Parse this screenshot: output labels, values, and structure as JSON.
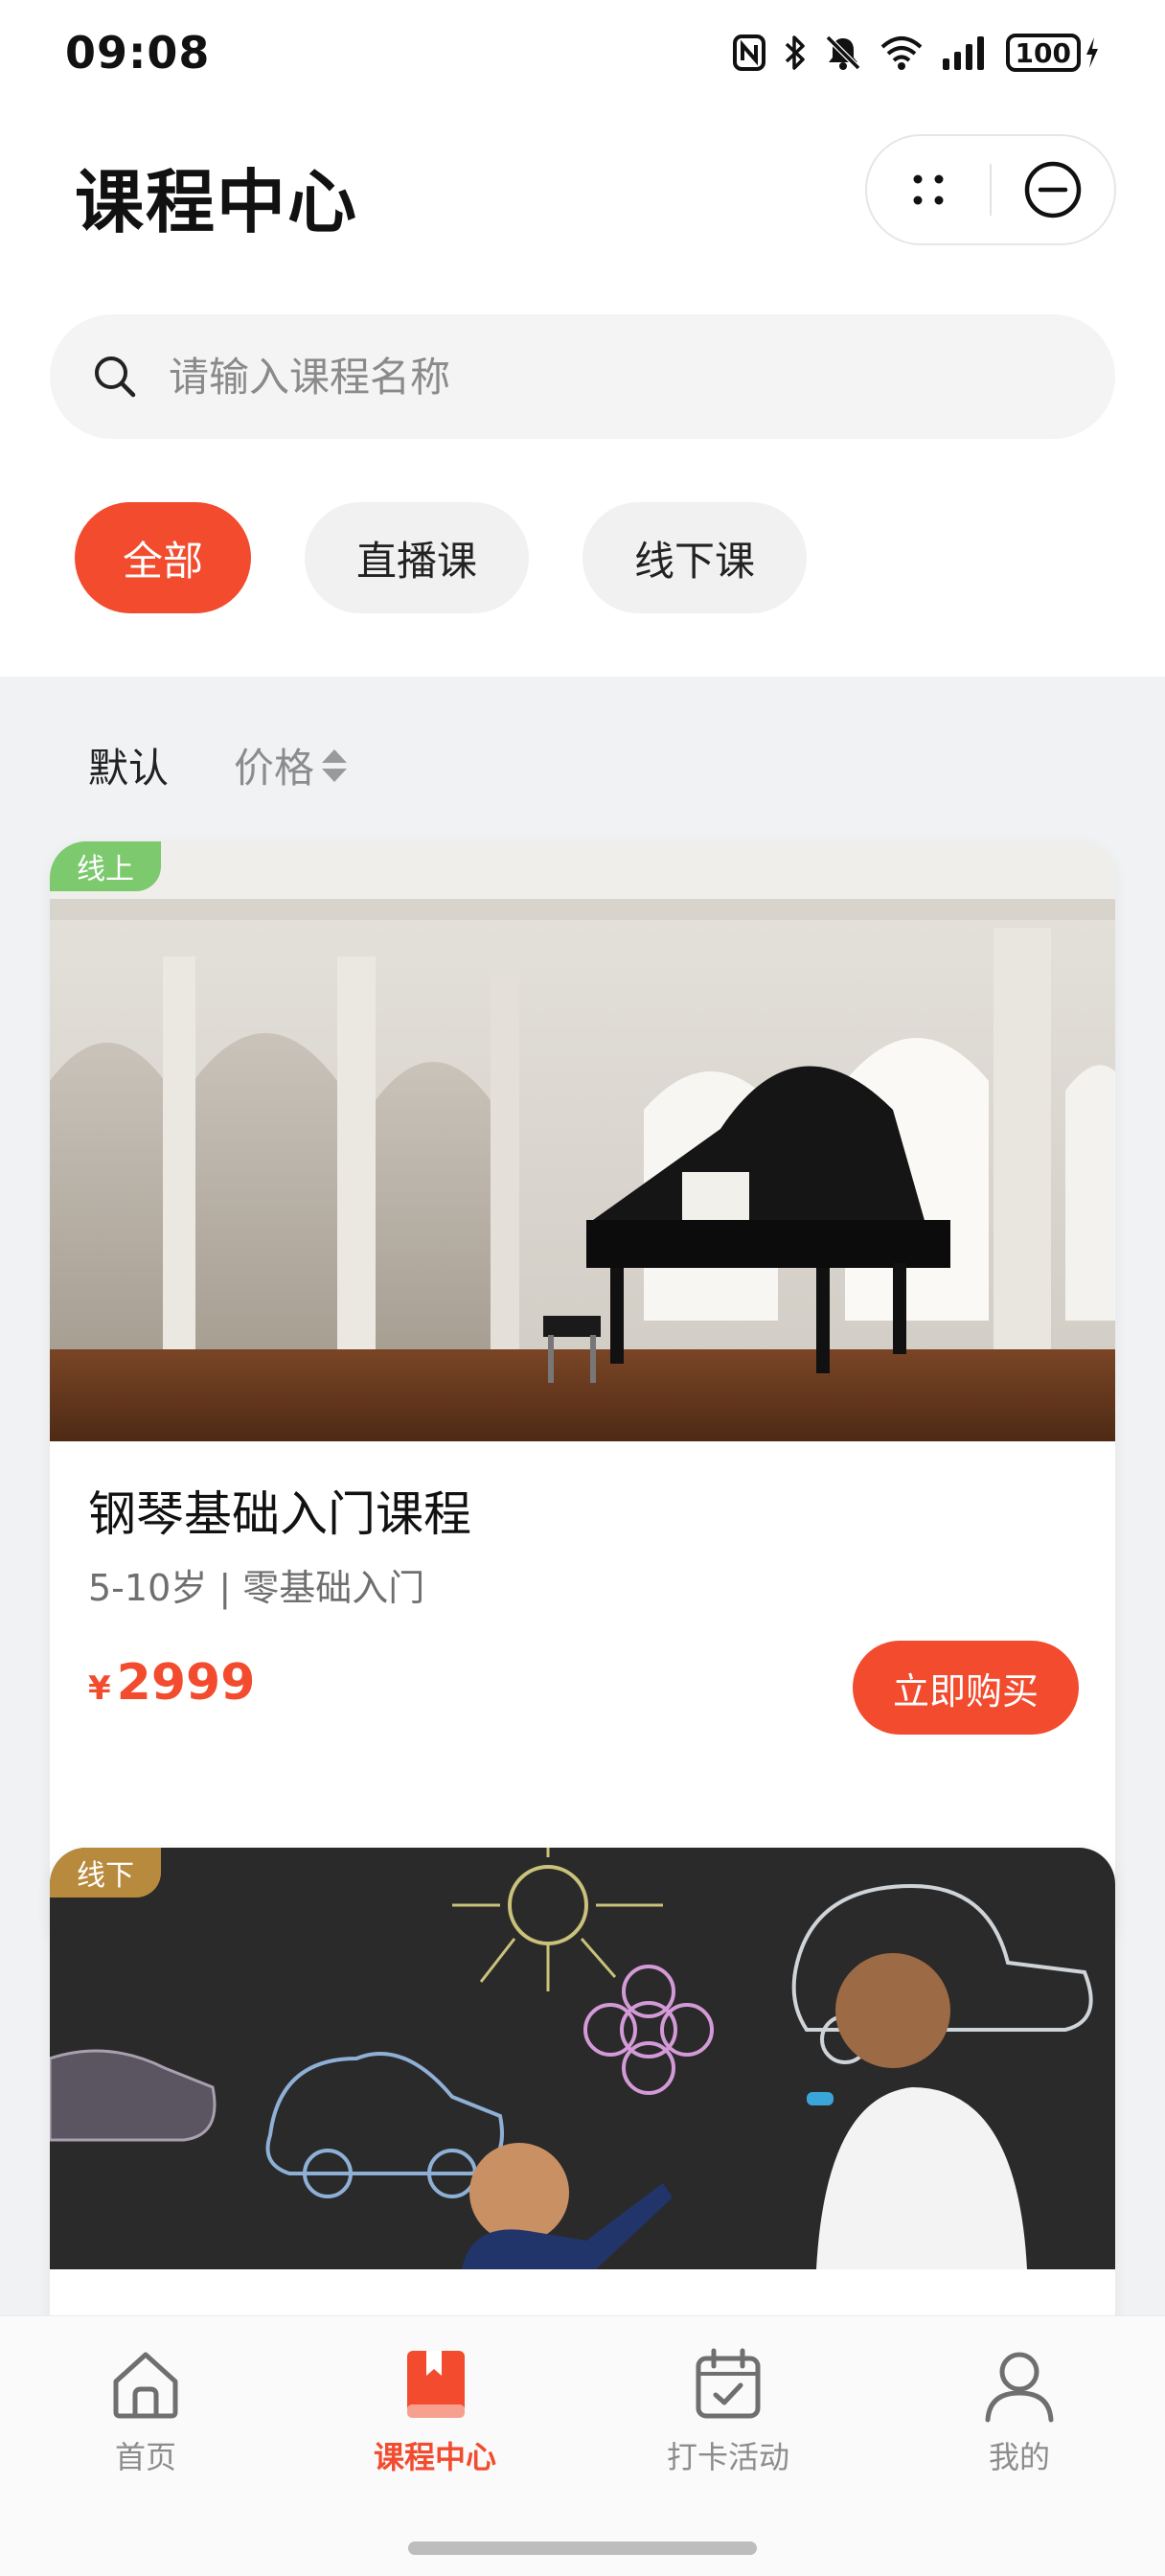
{
  "status_bar": {
    "time": "09:08",
    "battery": "100",
    "icons": [
      "nfc-icon",
      "bluetooth-icon",
      "mute-icon",
      "wifi-icon",
      "signal-icon",
      "battery-icon",
      "charging-icon"
    ]
  },
  "header": {
    "title": "课程中心",
    "capsule_icons": [
      "more-dots-icon",
      "close-circle-icon"
    ]
  },
  "search": {
    "placeholder": "请输入课程名称",
    "value": ""
  },
  "categories": [
    {
      "label": "全部",
      "active": true
    },
    {
      "label": "直播课",
      "active": false
    },
    {
      "label": "线下课",
      "active": false
    }
  ],
  "sort": {
    "default_label": "默认",
    "price_label": "价格"
  },
  "courses": [
    {
      "tag": "线上",
      "title": "钢琴基础入门课程",
      "subtitle": "5-10岁 | 零基础入门",
      "price_symbol": "¥",
      "price": "2999",
      "button": "立即购买"
    },
    {
      "tag": "线下"
    }
  ],
  "tabbar": [
    {
      "label": "首页",
      "icon": "home-icon",
      "active": false
    },
    {
      "label": "课程中心",
      "icon": "book-icon",
      "active": true
    },
    {
      "label": "打卡活动",
      "icon": "calendar-check-icon",
      "active": false
    },
    {
      "label": "我的",
      "icon": "user-icon",
      "active": false
    }
  ],
  "colors": {
    "accent": "#f24b2e",
    "online_tag": "#7cc96e",
    "offline_tag": "#b88a3d",
    "content_bg": "#f1f2f4"
  }
}
